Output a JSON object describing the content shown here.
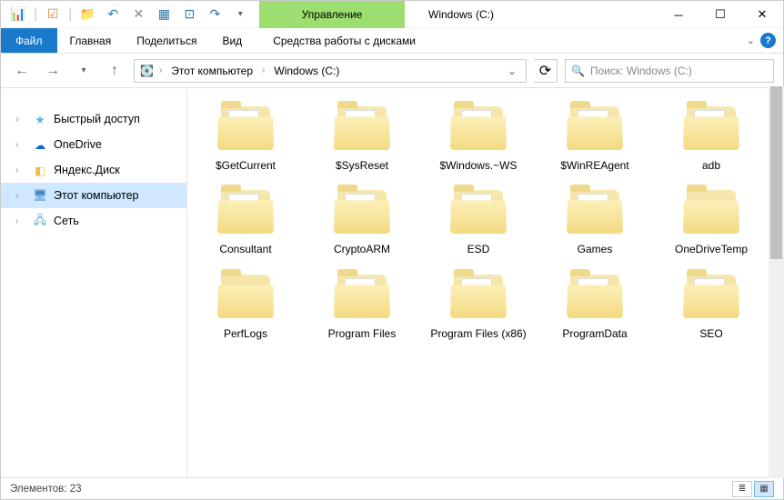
{
  "window": {
    "title": "Windows (C:)"
  },
  "ribbon": {
    "contextual_header": "Управление",
    "file": "Файл",
    "tabs": [
      "Главная",
      "Поделиться",
      "Вид"
    ],
    "contextual_tab": "Средства работы с дисками"
  },
  "breadcrumb": {
    "segments": [
      "Этот компьютер",
      "Windows (C:)"
    ]
  },
  "search": {
    "placeholder": "Поиск: Windows (C:)"
  },
  "tree": [
    {
      "label": "Быстрый доступ",
      "icon": "star",
      "color": "#4fb5ef"
    },
    {
      "label": "OneDrive",
      "icon": "cloud",
      "color": "#0a6cce"
    },
    {
      "label": "Яндекс.Диск",
      "icon": "yandex",
      "color": "#f3bd3c"
    },
    {
      "label": "Этот компьютер",
      "icon": "monitor",
      "color": "#3c8ac8",
      "selected": true
    },
    {
      "label": "Сеть",
      "icon": "network",
      "color": "#4aa0d8"
    }
  ],
  "folders": [
    {
      "name": "$GetCurrent",
      "doc": true
    },
    {
      "name": "$SysReset",
      "doc": true
    },
    {
      "name": "$Windows.~WS",
      "doc": true
    },
    {
      "name": "$WinREAgent",
      "doc": true
    },
    {
      "name": "adb",
      "doc": true
    },
    {
      "name": "Consultant",
      "doc": true
    },
    {
      "name": "CryptoARM",
      "doc": true,
      "nx": true
    },
    {
      "name": "ESD",
      "doc": true
    },
    {
      "name": "Games",
      "doc": true
    },
    {
      "name": "OneDriveTemp",
      "doc": false
    },
    {
      "name": "PerfLogs",
      "doc": false
    },
    {
      "name": "Program Files",
      "doc": true
    },
    {
      "name": "Program Files (x86)",
      "doc": true
    },
    {
      "name": "ProgramData",
      "doc": true
    },
    {
      "name": "SEO",
      "doc": true
    }
  ],
  "status": {
    "label": "Элементов:",
    "count": "23"
  }
}
